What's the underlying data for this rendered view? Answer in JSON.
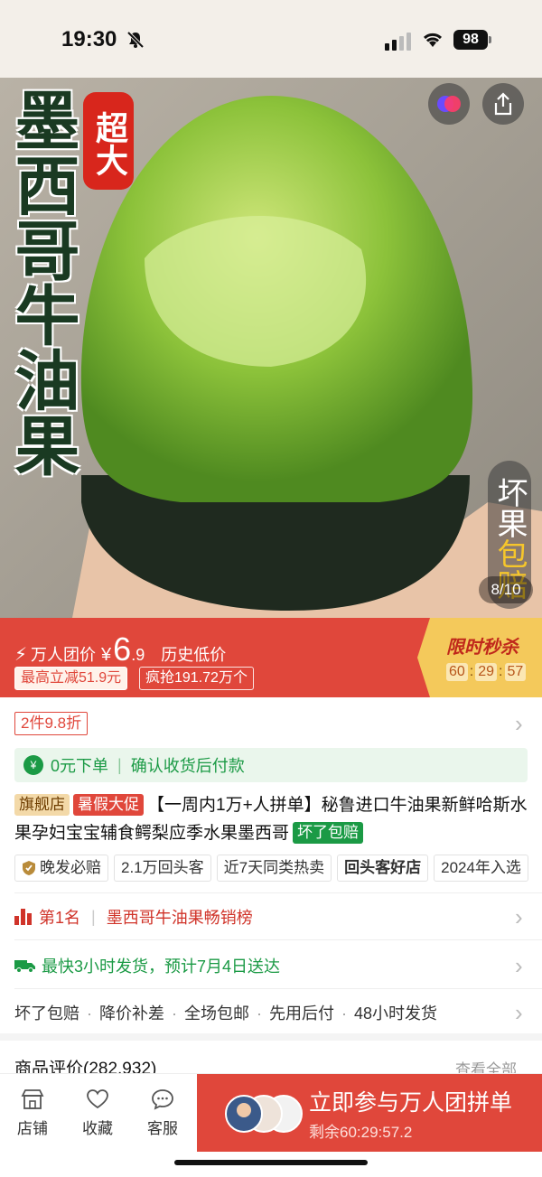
{
  "status": {
    "time": "19:30",
    "battery": "98"
  },
  "hero": {
    "vertical_title": "墨西哥牛油果",
    "badge": "超大",
    "tag_white": "坏果",
    "tag_yellow": "包赔",
    "pager": "8/10"
  },
  "price": {
    "label": "万人团价",
    "currency": "¥",
    "int": "6",
    "dec": ".9",
    "history": "历史低价",
    "tag_reduce": "最高立减51.9元",
    "tag_sold": "疯抢191.72万个"
  },
  "flash": {
    "title": "限时秒杀",
    "h": "60",
    "m": "29",
    "s": "57"
  },
  "info": {
    "discount": "2件9.8折",
    "zero_pay": "0元下单",
    "zero_pay_note": "确认收货后付款",
    "pill_flagship": "旗舰店",
    "pill_summer": "暑假大促",
    "title": "【一周内1万+人拼单】秘鲁进口牛油果新鲜哈斯水果孕妇宝宝辅食鳄梨应季水果墨西哥",
    "pill_guarantee": "坏了包赔",
    "chips": [
      "晚发必赔",
      "2.1万回头客",
      "近7天同类热卖",
      "回头客好店",
      "2024年入选"
    ],
    "rank_no": "第1名",
    "rank_list": "墨西哥牛油果畅销榜",
    "shipping": "最快3小时发货，预计7月4日送达",
    "services": [
      "坏了包赔",
      "降价补差",
      "全场包邮",
      "先用后付",
      "48小时发货"
    ]
  },
  "reviews": {
    "title": "商品评价(282,932)",
    "all": "查看全部"
  },
  "bottom": {
    "tabs": [
      "店铺",
      "收藏",
      "客服"
    ],
    "cta_main": "立即参与万人团拼单",
    "cta_sub": "剩余60:29:57.2"
  },
  "colors": {
    "accent": "#e0473b",
    "flash_bg": "#f4c95b",
    "green": "#1b9a45"
  }
}
